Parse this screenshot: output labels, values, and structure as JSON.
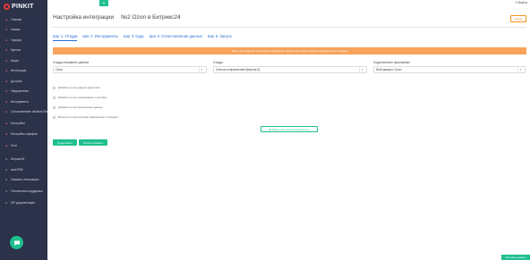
{
  "brand": {
    "logo_text": "PINKIT",
    "accent": "#1fbf8f",
    "sidebar_bg": "#2b3249",
    "link": "#2a6fd6",
    "warning": "#f7a35c"
  },
  "topbar": {
    "plus_label": "+",
    "exit_label": "Выйти"
  },
  "sidebar": {
    "items": [
      {
        "label": "Главная",
        "icon": "home-icon"
      },
      {
        "label": "Заказы",
        "icon": "cart-icon"
      },
      {
        "label": "Тарифы",
        "icon": "tag-icon"
      },
      {
        "label": "Купоны",
        "icon": "ticket-icon"
      },
      {
        "label": "Акции",
        "icon": "gift-icon"
      },
      {
        "label": "Интеграции",
        "icon": "plug-icon"
      },
      {
        "label": "Доступы",
        "icon": "key-icon"
      },
      {
        "label": "Уведомления",
        "icon": "bell-icon"
      },
      {
        "label": "Инструменты",
        "icon": "wrench-icon"
      },
      {
        "label": "Сопоставление свойств Stat",
        "icon": "link-icon"
      },
      {
        "label": "Настройки",
        "icon": "gear-icon"
      },
      {
        "label": "Настройка тарифов",
        "icon": "sliders-icon"
      },
      {
        "label": "Логи",
        "icon": "list-icon"
      }
    ],
    "bottom_items": [
      {
        "label": "Битрикс24",
        "icon": "b24-icon"
      },
      {
        "label": "amoCRM",
        "icon": "cloud-icon"
      },
      {
        "label": "Заказать интеграцию",
        "icon": "doc-icon"
      },
      {
        "label": "Техническая поддержка",
        "icon": "support-icon"
      },
      {
        "label": "API документация",
        "icon": "code-icon"
      }
    ]
  },
  "header": {
    "title": "Настройка интеграции",
    "subtitle": "№2 Ozon в Битрикс24",
    "back_label": "Назад"
  },
  "tabs": [
    {
      "label": "Шаг 1: Откуда",
      "active": true
    },
    {
      "label": "Шаг 2: Инструменты",
      "active": false
    },
    {
      "label": "Шаг 3: Куда",
      "active": false
    },
    {
      "label": "Шаг 4: Сопоставление данных",
      "active": false
    },
    {
      "label": "Шаг 5: Запуск",
      "active": false
    }
  ],
  "warning_text": "Если у вас возникли сложности с настройкой, обратитесь в нашу службу поддержки и мы поможем",
  "fields": {
    "source": {
      "label": "Откуда отправлять данные",
      "value": "Ozon"
    },
    "where": {
      "label": "Откуда",
      "value": "Список отправлений (версия 3)"
    },
    "app": {
      "label": "Подключенное приложение",
      "value": "Мой аккаунт Ozon"
    }
  },
  "checkboxes": [
    {
      "label": "Добавить в поле данные аналитики"
    },
    {
      "label": "Добавить в поле информацию о доставке"
    },
    {
      "label": "Добавить в поле финансовые данные"
    },
    {
      "label": "Включить в перечислении информацию о позициях"
    }
  ],
  "add_filter_label": "Добавить дополнительный фильтр",
  "buttons": {
    "continue": "Продолжить",
    "save": "Протестировать"
  },
  "support_label": "Тестовые данные"
}
